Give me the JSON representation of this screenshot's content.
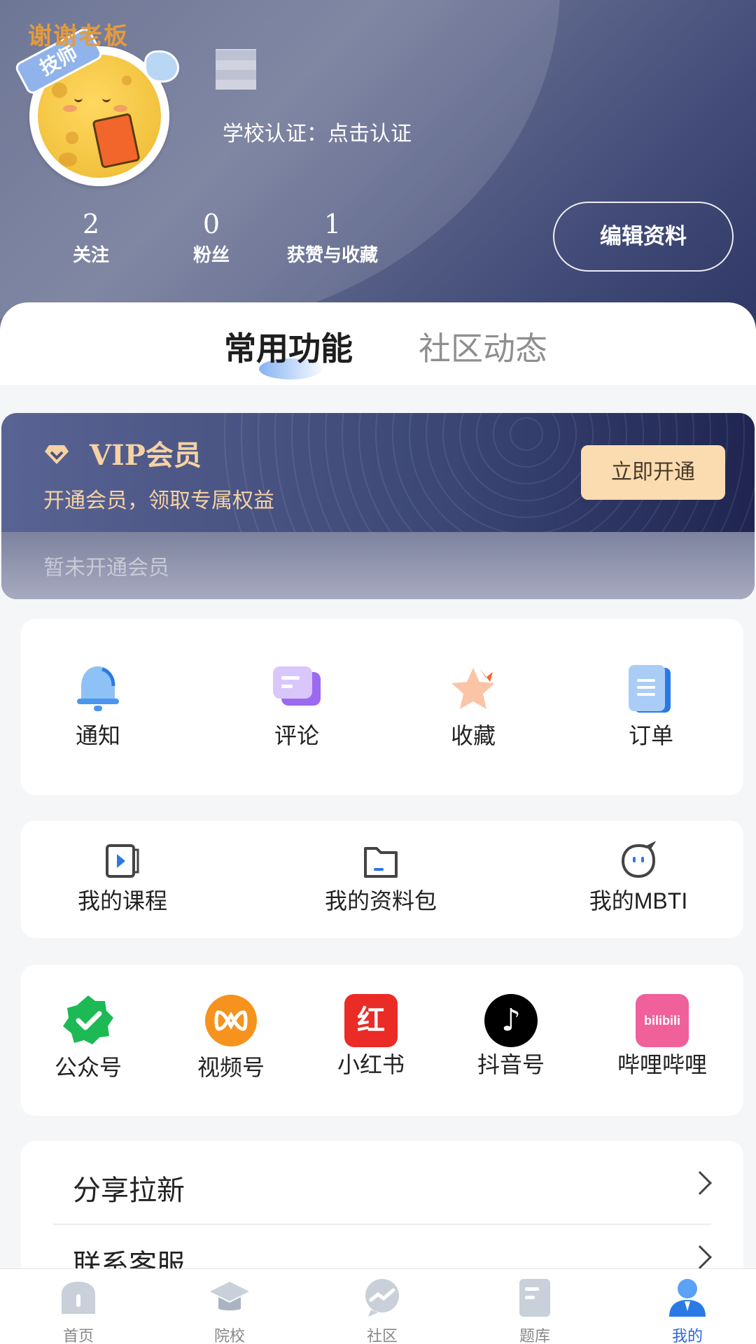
{
  "profile": {
    "avatar_text": "谢谢老板",
    "avatar_ribbon": "技师",
    "school_cert": "学校认证：点击认证",
    "edit_label": "编辑资料"
  },
  "stats": [
    {
      "num": "2",
      "label": "关注"
    },
    {
      "num": "0",
      "label": "粉丝"
    },
    {
      "num": "1",
      "label": "获赞与收藏"
    }
  ],
  "tabs": {
    "active": "常用功能",
    "inactive": "社区动态"
  },
  "vip": {
    "title": "VIP会员",
    "subtitle": "开通会员，领取专属权益",
    "button": "立即开通",
    "status": "暂未开通会员",
    "accent": "#f6d2a2"
  },
  "quick": [
    {
      "label": "通知",
      "icon": "bell-icon"
    },
    {
      "label": "评论",
      "icon": "comment-icon"
    },
    {
      "label": "收藏",
      "icon": "star-icon"
    },
    {
      "label": "订单",
      "icon": "order-icon"
    }
  ],
  "mine": [
    {
      "label": "我的课程",
      "icon": "course-icon"
    },
    {
      "label": "我的资料包",
      "icon": "folder-icon"
    },
    {
      "label": "我的MBTI",
      "icon": "mbti-icon"
    }
  ],
  "social": [
    {
      "label": "公众号",
      "icon": "wechat-official-icon",
      "color": "#1db954"
    },
    {
      "label": "视频号",
      "icon": "wechat-channels-icon",
      "color": "#f5931e"
    },
    {
      "label": "小红书",
      "icon": "xiaohongshu-icon",
      "color": "#ea2b26",
      "glyph": "红"
    },
    {
      "label": "抖音号",
      "icon": "douyin-icon",
      "color": "#000000",
      "glyph": "♪"
    },
    {
      "label": "哔哩哔哩",
      "icon": "bilibili-icon",
      "color": "#f0609a",
      "glyph": "bilibili"
    }
  ],
  "list": [
    {
      "label": "分享拉新"
    },
    {
      "label": "联系客服"
    }
  ],
  "tabbar": [
    {
      "label": "首页",
      "icon": "home-icon"
    },
    {
      "label": "院校",
      "icon": "school-icon"
    },
    {
      "label": "社区",
      "icon": "community-icon"
    },
    {
      "label": "题库",
      "icon": "question-bank-icon"
    },
    {
      "label": "我的",
      "icon": "profile-icon",
      "active": true
    }
  ]
}
